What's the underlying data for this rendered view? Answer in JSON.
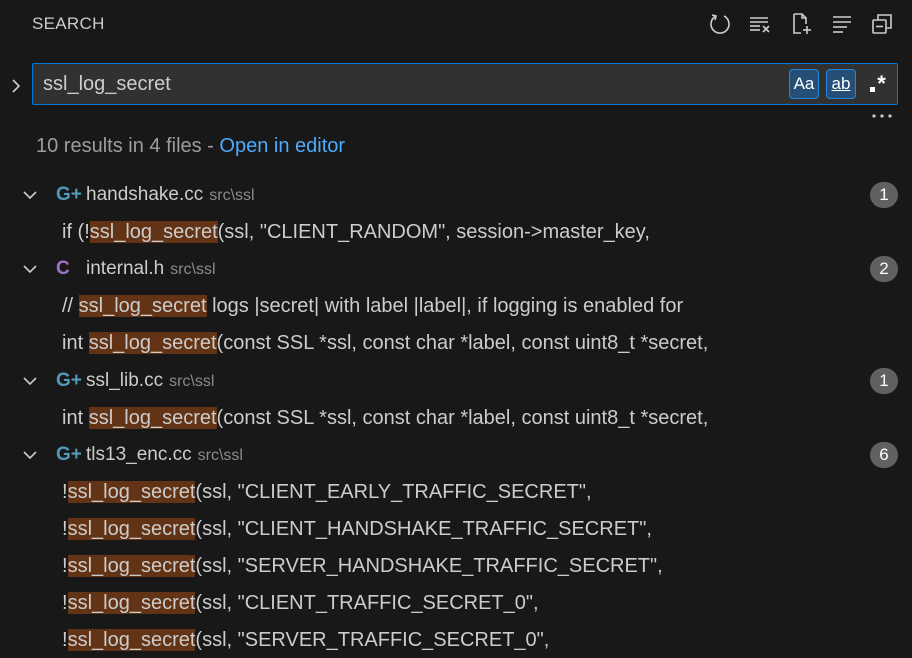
{
  "header": {
    "title": "SEARCH",
    "actions": [
      {
        "icon": "refresh-icon"
      },
      {
        "icon": "clear-results-icon"
      },
      {
        "icon": "new-search-editor-icon"
      },
      {
        "icon": "view-as-list-icon"
      },
      {
        "icon": "collapse-all-icon"
      }
    ]
  },
  "search": {
    "query": "ssl_log_secret",
    "match_case_label": "Aa",
    "whole_word_label": "ab",
    "regex_label": "*"
  },
  "summary": {
    "text": "10 results in 4 files - ",
    "link": "Open in editor"
  },
  "files": [
    {
      "name": "handshake.cc",
      "path": "src\\ssl",
      "icon": "cpp-file-icon",
      "icon_glyph": "G+",
      "count": "1",
      "matches": [
        {
          "before": "if (!",
          "match": "ssl_log_secret",
          "after": "(ssl, \"CLIENT_RANDOM\", session->master_key,"
        }
      ]
    },
    {
      "name": "internal.h",
      "path": "src\\ssl",
      "icon": "c-header-icon",
      "icon_glyph": "C",
      "count": "2",
      "matches": [
        {
          "before": "// ",
          "match": "ssl_log_secret",
          "after": " logs |secret| with label |label|, if logging is enabled for"
        },
        {
          "before": "int ",
          "match": "ssl_log_secret",
          "after": "(const SSL *ssl, const char *label, const uint8_t *secret,"
        }
      ]
    },
    {
      "name": "ssl_lib.cc",
      "path": "src\\ssl",
      "icon": "cpp-file-icon",
      "icon_glyph": "G+",
      "count": "1",
      "matches": [
        {
          "before": "int ",
          "match": "ssl_log_secret",
          "after": "(const SSL *ssl, const char *label, const uint8_t *secret,"
        }
      ]
    },
    {
      "name": "tls13_enc.cc",
      "path": "src\\ssl",
      "icon": "cpp-file-icon",
      "icon_glyph": "G+",
      "count": "6",
      "matches": [
        {
          "before": "!",
          "match": "ssl_log_secret",
          "after": "(ssl, \"CLIENT_EARLY_TRAFFIC_SECRET\","
        },
        {
          "before": "!",
          "match": "ssl_log_secret",
          "after": "(ssl, \"CLIENT_HANDSHAKE_TRAFFIC_SECRET\","
        },
        {
          "before": "!",
          "match": "ssl_log_secret",
          "after": "(ssl, \"SERVER_HANDSHAKE_TRAFFIC_SECRET\","
        },
        {
          "before": "!",
          "match": "ssl_log_secret",
          "after": "(ssl, \"CLIENT_TRAFFIC_SECRET_0\","
        },
        {
          "before": "!",
          "match": "ssl_log_secret",
          "after": "(ssl, \"SERVER_TRAFFIC_SECRET_0\","
        }
      ]
    }
  ],
  "colors": {
    "background": "#181818",
    "accent": "#0078d4",
    "highlight": "#623315",
    "link": "#4daafc"
  }
}
